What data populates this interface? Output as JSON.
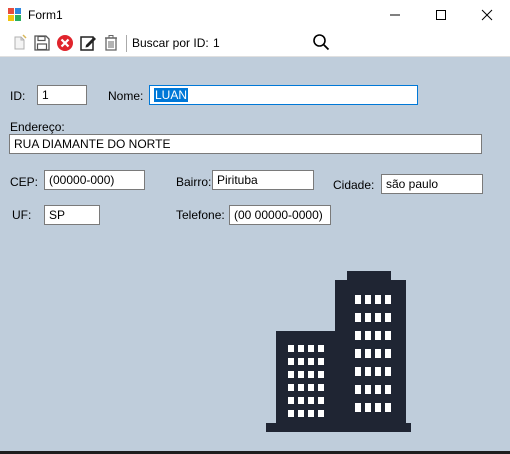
{
  "window": {
    "title": "Form1"
  },
  "toolbar": {
    "icons": [
      "new-icon",
      "save-icon",
      "delete-icon",
      "edit-icon",
      "trash-icon",
      "search-icon"
    ],
    "search_label": "Buscar por ID:",
    "search_value": "1"
  },
  "form": {
    "id": {
      "label": "ID:",
      "value": "1"
    },
    "nome": {
      "label": "Nome:",
      "value": "LUAN"
    },
    "endereco": {
      "label": "Endereço:",
      "value": "RUA DIAMANTE DO NORTE"
    },
    "cep": {
      "label": "CEP:",
      "value": "(00000-000)"
    },
    "bairro": {
      "label": "Bairro:",
      "value": "Pirituba"
    },
    "cidade": {
      "label": "Cidade:",
      "value": "são paulo"
    },
    "uf": {
      "label": "UF:",
      "value": "SP"
    },
    "telefone": {
      "label": "Telefone:",
      "value": "(00 00000-0000)"
    }
  },
  "colors": {
    "form_background": "#bfcddb",
    "building": "#1f2533",
    "selection": "#0078d7"
  }
}
